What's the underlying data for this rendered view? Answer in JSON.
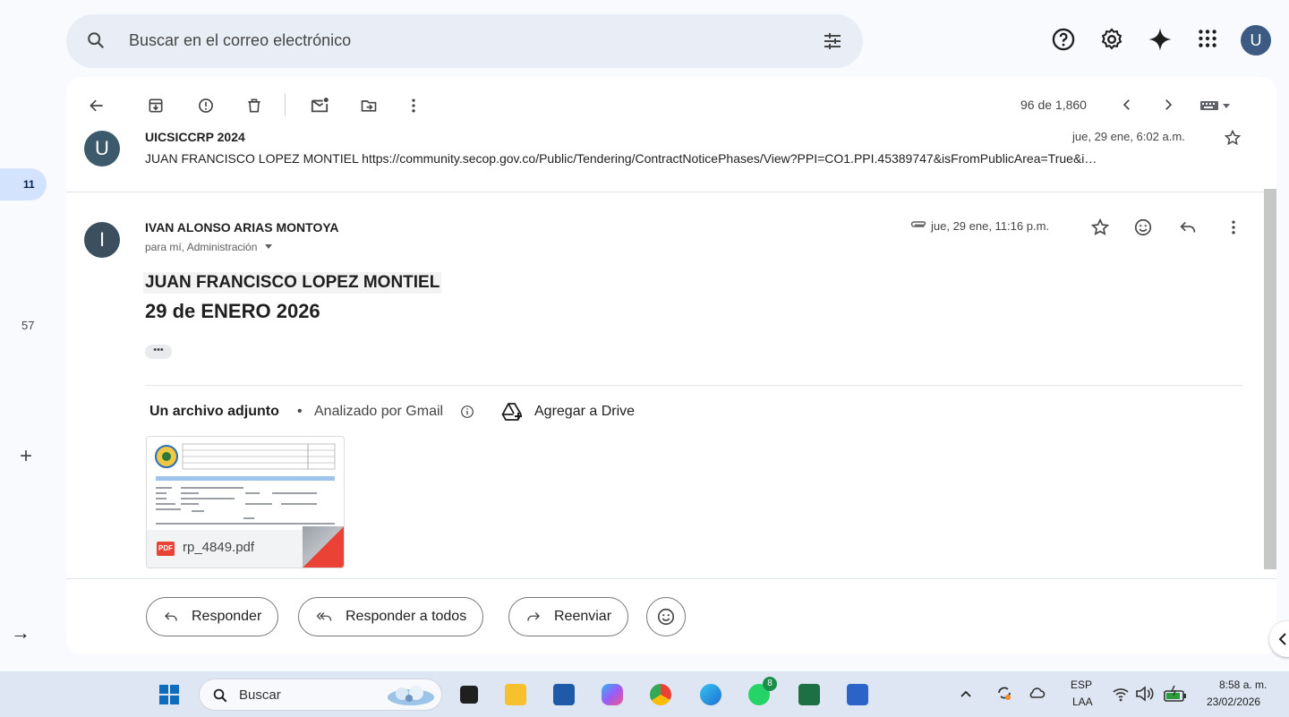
{
  "search": {
    "placeholder": "Buscar en el correo electrónico"
  },
  "header": {
    "avatar_letter": "U"
  },
  "rail": {
    "badge": "11",
    "count": "57"
  },
  "toolbar": {
    "pager": "96 de 1,860"
  },
  "previous_message": {
    "avatar_letter": "U",
    "sender": "UICSICCRP 2024",
    "date": "jue, 29 ene, 6:02 a.m.",
    "snippet": "JUAN FRANCISCO LOPEZ MONTIEL https://community.secop.gov.co/Public/Tendering/ContractNoticePhases/View?PPI=CO1.PPI.45389747&isFromPublicArea=True&i…"
  },
  "message": {
    "avatar_letter": "I",
    "sender": "IVAN ALONSO ARIAS MONTOYA",
    "to_line": "para mí, Administración",
    "date": "jue, 29 ene, 11:16 p.m.",
    "body_name": "JUAN FRANCISCO LOPEZ MONTIEL",
    "body_date": "29 de ENERO 2026",
    "ellipsis": "•••"
  },
  "attachments": {
    "title": "Un archivo adjunto",
    "separator": "•",
    "scanned": "Analizado por Gmail",
    "add_drive": "Agregar a Drive",
    "file_badge": "PDF",
    "file_name": "rp_4849.pdf"
  },
  "actions": {
    "reply": "Responder",
    "reply_all": "Responder a todos",
    "forward": "Reenviar"
  },
  "taskbar": {
    "search": "Buscar",
    "whatsapp_badge": "8",
    "lang_top": "ESP",
    "lang_bottom": "LAA",
    "time": "8:58 a. m.",
    "date": "23/02/2026"
  }
}
